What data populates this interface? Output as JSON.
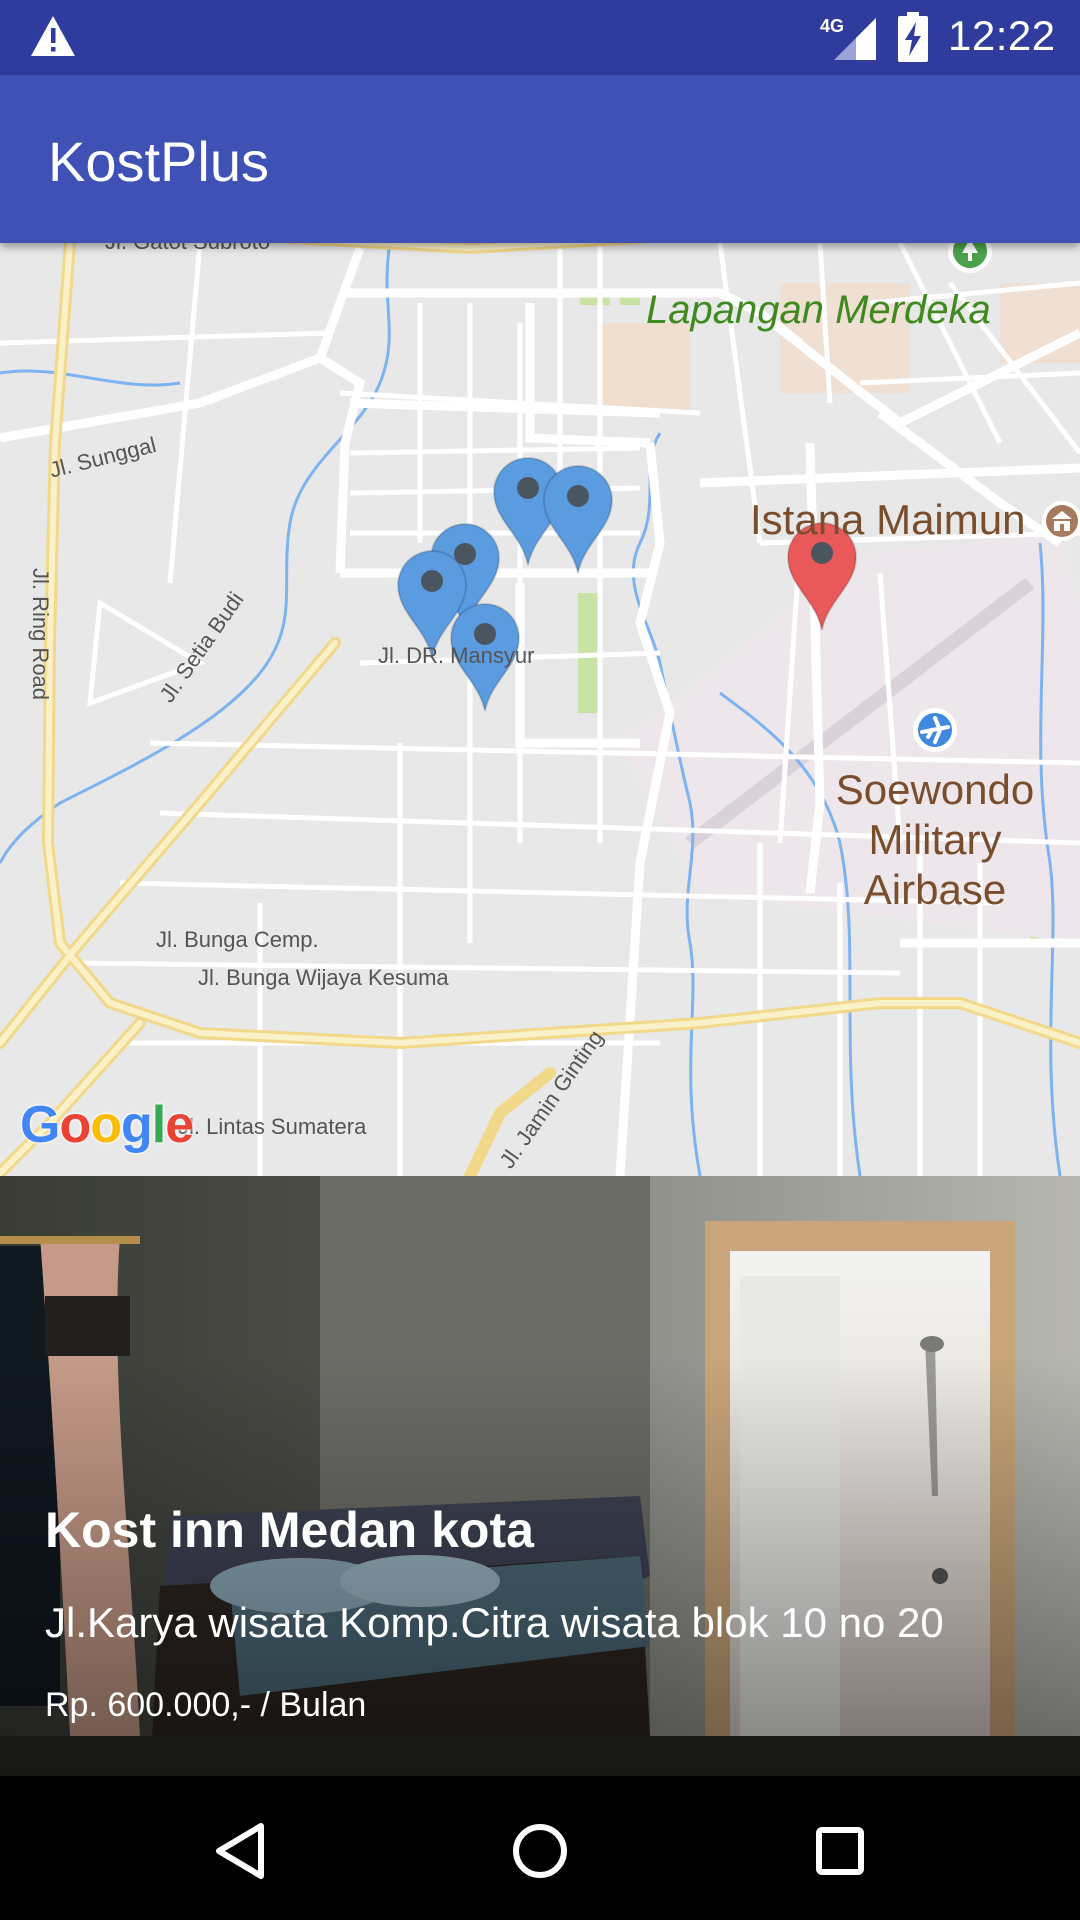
{
  "status_bar": {
    "time": "12:22",
    "network": "4G",
    "icons": [
      "warning-icon",
      "signal-4g-icon",
      "battery-charging-icon"
    ]
  },
  "app_bar": {
    "title": "KostPlus"
  },
  "map": {
    "labels": {
      "gatot": "Jl. Gatot Subroto",
      "lapangan": "Lapangan Merdeka",
      "sunggal": "Jl. Sunggal",
      "ring_road": "Jl. Ring Road",
      "istana": "Istana Maimun",
      "mansyur": "Jl. DR. Mansyur",
      "setia_budi": "Jl. Setia Budi",
      "soewondo_1": "Soewondo",
      "soewondo_2": "Military",
      "soewondo_3": "Airbase",
      "bunga_cemp": "Jl. Bunga Cemp.",
      "bunga_wijaya": "Jl. Bunga Wijaya Kesuma",
      "lintas": "Jl. Lintas Sumatera",
      "jamin": "Jl. Jamin Ginting"
    },
    "google_logo": "Google",
    "markers": [
      {
        "color": "blue"
      },
      {
        "color": "blue"
      },
      {
        "color": "blue"
      },
      {
        "color": "blue"
      },
      {
        "color": "blue"
      },
      {
        "color": "red"
      }
    ],
    "colors": {
      "marker_blue": "#5B9BE0",
      "marker_red": "#E9595A",
      "road_major": "#F6E7A5",
      "road_minor": "#FFFFFF",
      "water": "#7DB3F0",
      "park": "#C9E3A5"
    }
  },
  "listing": {
    "title": "Kost inn Medan kota",
    "address": "Jl.Karya wisata Komp.Citra wisata blok 10 no 20",
    "price": "Rp. 600.000,- / Bulan"
  },
  "nav_bar": {
    "buttons": [
      "back-icon",
      "home-icon",
      "recents-icon"
    ]
  },
  "theme": {
    "primary": "#3F51B5",
    "primary_dark": "#2F3C9E"
  }
}
